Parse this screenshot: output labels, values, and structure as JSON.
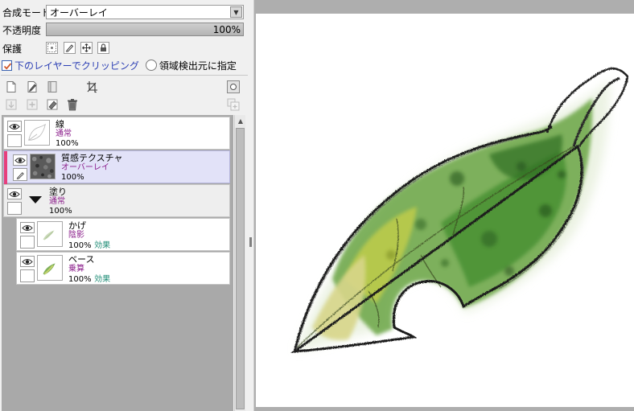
{
  "properties": {
    "blend_label": "合成モード",
    "blend_value": "オーバーレイ",
    "opacity_label": "不透明度",
    "opacity_value": "100%",
    "opacity_fraction": 1.0,
    "protect_label": "保護",
    "clip_label": "下のレイヤーでクリッピング",
    "clip_checked": true,
    "area_label": "領域検出元に指定",
    "area_checked": false
  },
  "toolbar": {
    "row1": [
      "new-layer-icon",
      "pen-layer-icon",
      "folder-icon",
      "transform-icon",
      "record-icon"
    ],
    "row2": [
      "transfer-down-icon",
      "merge-icon",
      "clear-icon",
      "trash-icon",
      "merge-visible-icon"
    ]
  },
  "layers": [
    {
      "name": "線",
      "mode": "通常",
      "opacity": "100%",
      "effect": "",
      "selected": false
    },
    {
      "name": "質感テクスチャ",
      "mode": "オーバーレイ",
      "opacity": "100%",
      "effect": "",
      "selected": true
    },
    {
      "name": "塗り",
      "mode": "通常",
      "opacity": "100%",
      "effect": "",
      "selected": false,
      "folder": true
    },
    {
      "name": "かげ",
      "mode": "陰影",
      "opacity": "100%",
      "effect": "効果",
      "selected": false
    },
    {
      "name": "ベース",
      "mode": "乗算",
      "opacity": "100%",
      "effect": "効果",
      "selected": false
    }
  ],
  "colors": {
    "selected_marker": "#e73f7c",
    "mode_text": "#8a1c8a",
    "effect_text": "#1a8a73",
    "clip_text": "#2c3fb4"
  }
}
